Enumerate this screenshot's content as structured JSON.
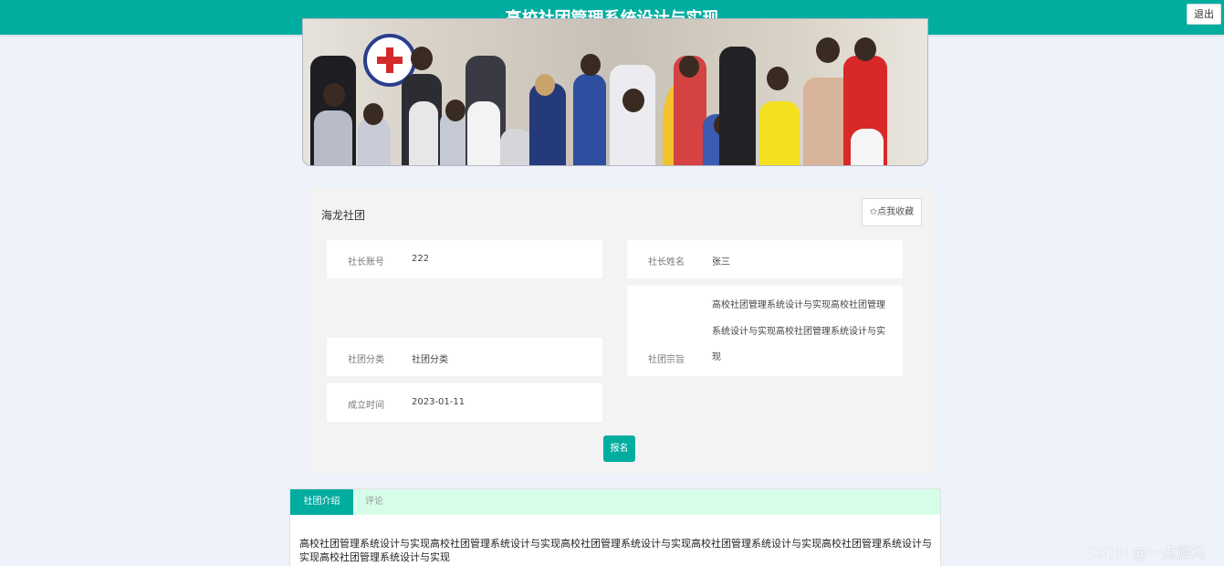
{
  "header": {
    "title": "高校社团管理系统设计与实现",
    "logout_label": "退出",
    "background_color": "#00ad9f"
  },
  "club": {
    "name": "海龙社团",
    "favorite_label": "✩点我收藏",
    "fields": {
      "leader_account": {
        "label": "社长账号",
        "value": "222"
      },
      "leader_name": {
        "label": "社长姓名",
        "value": "张三"
      },
      "category": {
        "label": "社团分类",
        "value": "社团分类"
      },
      "aim": {
        "label": "社团宗旨",
        "value": "高校社团管理系统设计与实现高校社团管理系统设计与实现高校社团管理系统设计与实现"
      },
      "founded": {
        "label": "成立时间",
        "value": "2023-01-11"
      }
    },
    "signup_label": "报名"
  },
  "tabs": [
    {
      "label": "社团介绍",
      "active": true
    },
    {
      "label": "评论",
      "active": false
    }
  ],
  "intro_text": "高校社团管理系统设计与实现高校社团管理系统设计与实现高校社团管理系统设计与实现高校社团管理系统设计与实现高校社团管理系统设计与实现高校社团管理系统设计与实现",
  "watermark": "CSDN @一点源码",
  "icons": {
    "cursor": "mouse-pointer-icon",
    "star": "star-outline-icon"
  }
}
